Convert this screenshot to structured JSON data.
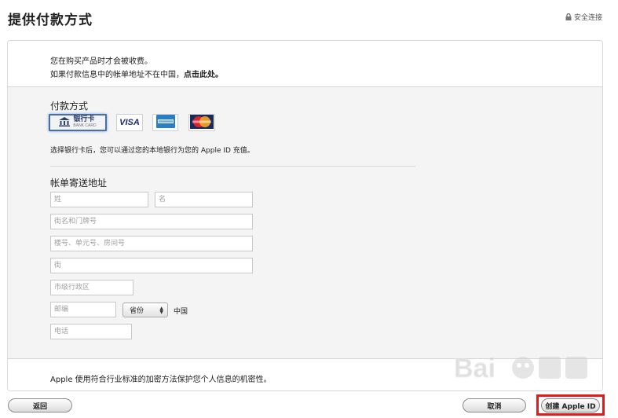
{
  "header": {
    "title": "提供付款方式",
    "secure_link": "安全连接"
  },
  "notices": {
    "line1": "您在购买产品时才会被收费。",
    "line2_prefix": "如果付款信息中的帐单地址不在中国，",
    "line2_link": "点击此处。"
  },
  "payment": {
    "section_title": "付款方式",
    "methods": [
      {
        "id": "bank",
        "label": "银行卡",
        "sublabel": "BANK CARD",
        "selected": true
      },
      {
        "id": "visa",
        "label": "VISA"
      },
      {
        "id": "amex",
        "label": "AMERICAN EXPRESS"
      },
      {
        "id": "mastercard",
        "label": "MasterCard"
      }
    ],
    "hint": "选择银行卡后，您可以通过您的本地银行为您的 Apple ID 充值。"
  },
  "billing": {
    "section_title": "帐单寄送地址",
    "fields": {
      "last_name": {
        "placeholder": "姓",
        "value": ""
      },
      "first_name": {
        "placeholder": "名",
        "value": ""
      },
      "street": {
        "placeholder": "街名和门牌号",
        "value": ""
      },
      "building": {
        "placeholder": "楼号、单元号、房间号",
        "value": ""
      },
      "street2": {
        "placeholder": "街",
        "value": ""
      },
      "district": {
        "placeholder": "市级行政区",
        "value": ""
      },
      "postcode": {
        "placeholder": "邮编",
        "value": ""
      },
      "phone": {
        "placeholder": "电话",
        "value": ""
      }
    },
    "province_select": "省份",
    "country": "中国"
  },
  "footer_note": "Apple 使用符合行业标准的加密方法保护您个人信息的机密性。",
  "buttons": {
    "back": "返回",
    "cancel": "取消",
    "create": "创建 Apple ID"
  },
  "colors": {
    "highlight": "#e01c1c",
    "selected_border": "#4a6ea8"
  }
}
